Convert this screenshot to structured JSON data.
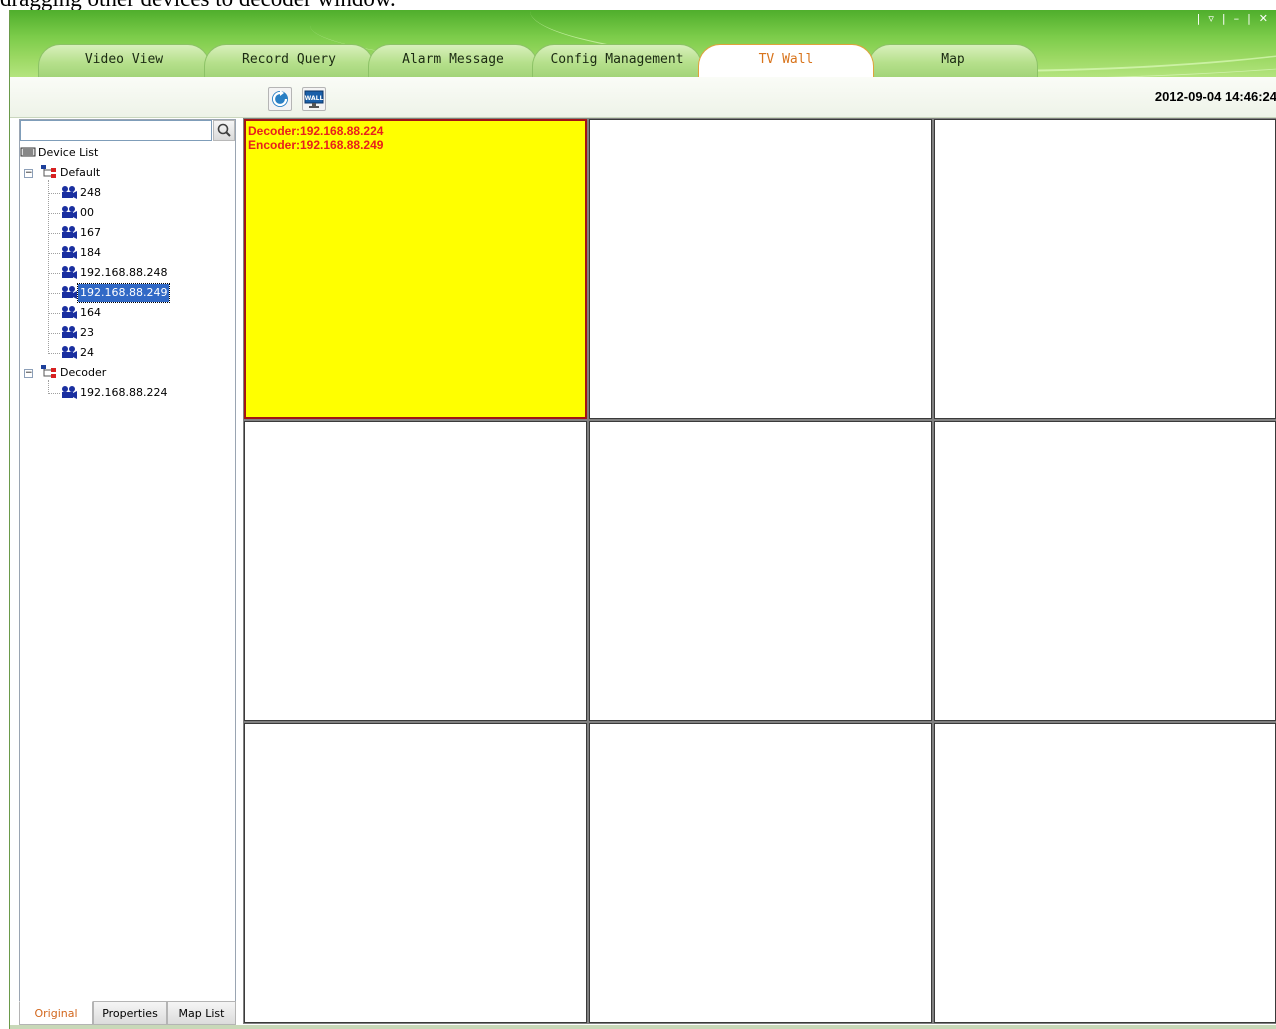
{
  "caption": "dragging other devices to decoder window.",
  "window_controls": [
    "|",
    "▿",
    "|",
    "–",
    "|",
    "✕"
  ],
  "tabs": [
    {
      "label": "Video View"
    },
    {
      "label": "Record Query"
    },
    {
      "label": "Alarm Message"
    },
    {
      "label": "Config Management"
    },
    {
      "label": "TV Wall",
      "active": true
    },
    {
      "label": "Map"
    }
  ],
  "toolbar": {
    "refresh_icon": "refresh-icon",
    "wall_icon": "tv-wall-icon",
    "wall_label": "WALL",
    "datetime": "2012-09-04 14:46:24"
  },
  "search": {
    "value": "",
    "placeholder": ""
  },
  "tree": {
    "root": "Device List",
    "groups": [
      {
        "name": "Default",
        "devices": [
          "248",
          "00",
          "167",
          "184",
          "192.168.88.248",
          "192.168.88.249",
          "164",
          "23",
          "24"
        ]
      },
      {
        "name": "Decoder",
        "devices": [
          "192.168.88.224"
        ]
      }
    ],
    "selected": "192.168.88.249"
  },
  "bottom_tabs": [
    {
      "label": "Original",
      "active": true
    },
    {
      "label": "Properties"
    },
    {
      "label": "Map List"
    }
  ],
  "wall": {
    "rows": 3,
    "cols": 3,
    "active_cell": {
      "decoder": "Decoder:192.168.88.224",
      "encoder": "Encoder:192.168.88.249"
    }
  },
  "colors": {
    "title_green": "#7ccc4a",
    "active_tab_text": "#d8741c",
    "active_cell_bg": "#ffff00",
    "active_cell_text": "#e8201c",
    "selection": "#3169c6"
  }
}
